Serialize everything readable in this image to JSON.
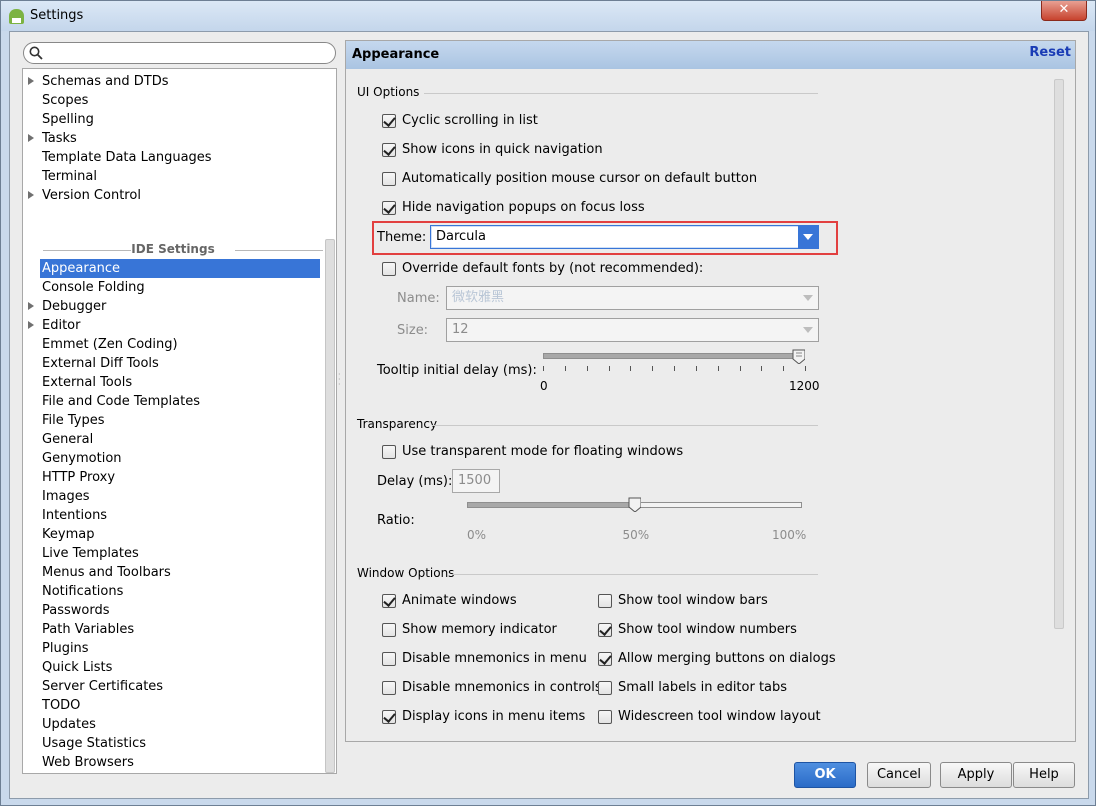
{
  "window": {
    "title": "Settings",
    "close_label": "✕"
  },
  "search": {
    "value": "",
    "placeholder": ""
  },
  "sidebar": {
    "partial_item": "·····",
    "project_items": [
      {
        "label": "Schemas and DTDs",
        "expandable": true
      },
      {
        "label": "Scopes",
        "expandable": false
      },
      {
        "label": "Spelling",
        "expandable": false
      },
      {
        "label": "Tasks",
        "expandable": true
      },
      {
        "label": "Template Data Languages",
        "expandable": false
      },
      {
        "label": "Terminal",
        "expandable": false
      },
      {
        "label": "Version Control",
        "expandable": true
      }
    ],
    "section_label": "IDE Settings",
    "ide_items": [
      {
        "label": "Appearance",
        "selected": true,
        "expandable": false
      },
      {
        "label": "Console Folding",
        "expandable": false
      },
      {
        "label": "Debugger",
        "expandable": true
      },
      {
        "label": "Editor",
        "expandable": true
      },
      {
        "label": "Emmet (Zen Coding)",
        "expandable": false
      },
      {
        "label": "External Diff Tools",
        "expandable": false
      },
      {
        "label": "External Tools",
        "expandable": false
      },
      {
        "label": "File and Code Templates",
        "expandable": false
      },
      {
        "label": "File Types",
        "expandable": false
      },
      {
        "label": "General",
        "expandable": false
      },
      {
        "label": "Genymotion",
        "expandable": false
      },
      {
        "label": "HTTP Proxy",
        "expandable": false
      },
      {
        "label": "Images",
        "expandable": false
      },
      {
        "label": "Intentions",
        "expandable": false
      },
      {
        "label": "Keymap",
        "expandable": false
      },
      {
        "label": "Live Templates",
        "expandable": false
      },
      {
        "label": "Menus and Toolbars",
        "expandable": false
      },
      {
        "label": "Notifications",
        "expandable": false
      },
      {
        "label": "Passwords",
        "expandable": false
      },
      {
        "label": "Path Variables",
        "expandable": false
      },
      {
        "label": "Plugins",
        "expandable": false
      },
      {
        "label": "Quick Lists",
        "expandable": false
      },
      {
        "label": "Server Certificates",
        "expandable": false
      },
      {
        "label": "TODO",
        "expandable": false
      },
      {
        "label": "Updates",
        "expandable": false
      },
      {
        "label": "Usage Statistics",
        "expandable": false
      },
      {
        "label": "Web Browsers",
        "expandable": false
      }
    ]
  },
  "panel": {
    "title": "Appearance",
    "reset_label": "Reset",
    "ui_options": {
      "label": "UI Options",
      "checkboxes": [
        {
          "label": "Cyclic scrolling in list",
          "checked": true
        },
        {
          "label": "Show icons in quick navigation",
          "checked": true
        },
        {
          "label": "Automatically position mouse cursor on default button",
          "checked": false
        },
        {
          "label": "Hide navigation popups on focus loss",
          "checked": true
        }
      ],
      "theme_label": "Theme:",
      "theme_value": "Darcula",
      "override_fonts": {
        "label": "Override default fonts by (not recommended):",
        "checked": false
      },
      "name_label": "Name:",
      "name_value": "微软雅黑",
      "size_label": "Size:",
      "size_value": "12",
      "tooltip_label": "Tooltip initial delay (ms):",
      "tooltip_min": "0",
      "tooltip_max": "1200",
      "tooltip_value_fraction": 1.0
    },
    "transparency": {
      "label": "Transparency",
      "checkbox": {
        "label": "Use transparent mode for floating windows",
        "checked": false
      },
      "delay_label": "Delay (ms):",
      "delay_value": "1500",
      "ratio_label": "Ratio:",
      "ratio_ticks": [
        "0%",
        "50%",
        "100%"
      ],
      "ratio_value_fraction": 0.5
    },
    "window_options": {
      "label": "Window Options",
      "left": [
        {
          "label": "Animate windows",
          "checked": true
        },
        {
          "label": "Show memory indicator",
          "checked": false
        },
        {
          "label": "Disable mnemonics in menu",
          "checked": false
        },
        {
          "label": "Disable mnemonics in controls",
          "checked": false
        },
        {
          "label": "Display icons in menu items",
          "checked": true
        }
      ],
      "right": [
        {
          "label": "Show tool window bars",
          "checked": false
        },
        {
          "label": "Show tool window numbers",
          "checked": true
        },
        {
          "label": "Allow merging buttons on dialogs",
          "checked": true
        },
        {
          "label": "Small labels in editor tabs",
          "checked": false
        },
        {
          "label": "Widescreen tool window layout",
          "checked": false
        }
      ]
    }
  },
  "buttons": {
    "ok": "OK",
    "cancel": "Cancel",
    "apply": "Apply",
    "help": "Help"
  },
  "colors": {
    "accent": "#3875d7",
    "highlight": "#e24040",
    "header": "#aac4e2"
  }
}
